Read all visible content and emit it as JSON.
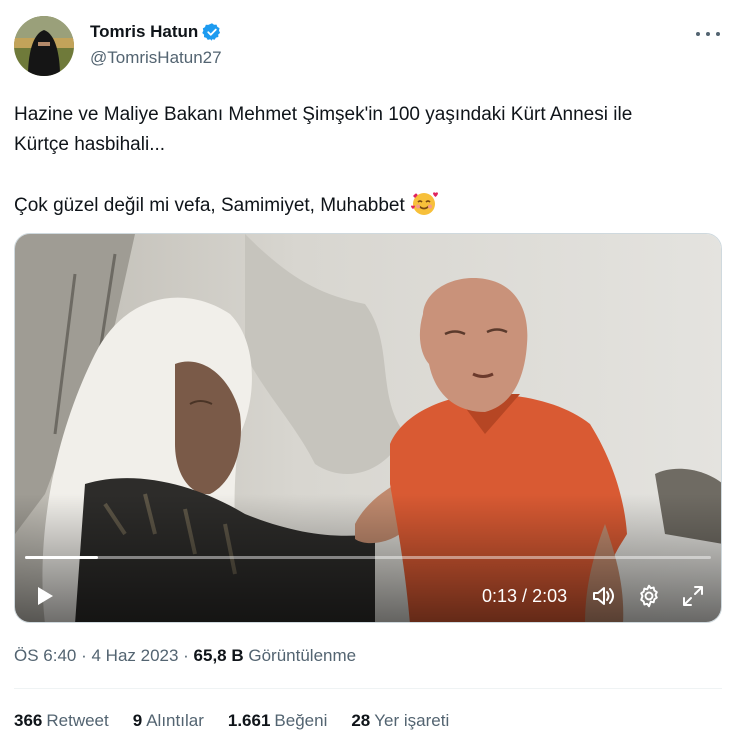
{
  "author": {
    "display_name": "Tomris Hatun",
    "handle": "@TomrisHatun27",
    "verified": true,
    "verified_color": "#1d9bf0"
  },
  "tweet": {
    "line1": "Hazine ve Maliye Bakanı Mehmet Şimşek'in 100 yaşındaki Kürt Annesi ile",
    "line2": "Kürtçe hasbihali...",
    "line3": "Çok güzel değil mi vefa, Samimiyet, Muhabbet",
    "emoji": "smiling-face-with-hearts-emoji"
  },
  "video": {
    "current_time": "0:13",
    "separator": " / ",
    "duration": "2:03",
    "progress_fraction": 0.106
  },
  "meta": {
    "time": "ÖS 6:40",
    "dot1": " · ",
    "date": "4 Haz 2023",
    "dot2": " · ",
    "views_count": "65,8 B",
    "views_label": "Görüntülenme"
  },
  "stats": [
    {
      "count": "366",
      "label": "Retweet"
    },
    {
      "count": "9",
      "label": "Alıntılar"
    },
    {
      "count": "1.661",
      "label": "Beğeni"
    },
    {
      "count": "28",
      "label": "Yer işareti"
    }
  ],
  "icons": {
    "more": "more-horizontal-icon",
    "play": "play-icon",
    "volume": "volume-icon",
    "settings": "gear-icon",
    "fullscreen": "expand-icon"
  }
}
